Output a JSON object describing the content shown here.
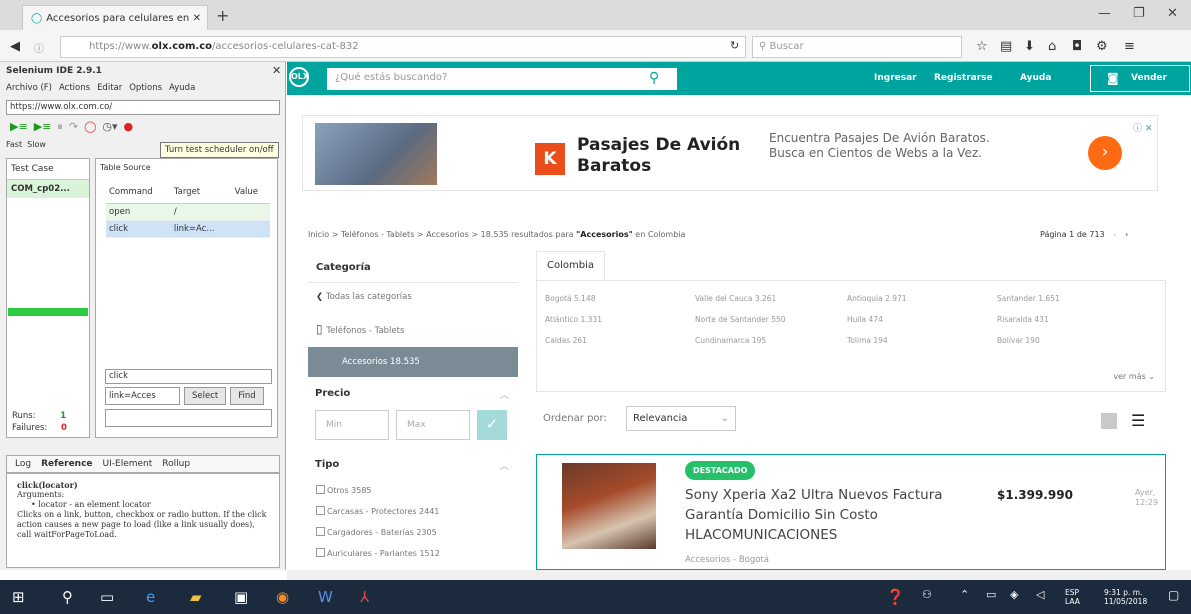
{
  "browser": {
    "tab_title": "Accesorios para celulares en",
    "url_prefix": "https://www.",
    "url_domain": "olx.com.co",
    "url_path": "/accesorios-celulares-cat-832",
    "search_placeholder": "Buscar"
  },
  "selenium": {
    "title": "Selenium IDE 2.9.1",
    "menu": [
      "Archivo (F)",
      "Actions",
      "Editar",
      "Options",
      "Ayuda"
    ],
    "base_url": "https://www.olx.com.co/",
    "speed_fast": "Fast",
    "speed_slow": "Slow",
    "tooltip": "Turn test scheduler on/off",
    "testcase_header": "Test Case",
    "testcase_item": "COM_cp02...",
    "editor_tab_table": "Table",
    "editor_tab_source": "Source",
    "col_command": "Command",
    "col_target": "Target",
    "col_value": "Value",
    "rows": [
      {
        "command": "open",
        "target": "/",
        "value": ""
      },
      {
        "command": "click",
        "target": "link=Ac...",
        "value": ""
      }
    ],
    "command_value": "click",
    "target_value": "link=Acces",
    "select_label": "Select",
    "find_label": "Find",
    "runs_label": "Runs:",
    "runs_value": "1",
    "failures_label": "Failures:",
    "failures_value": "0",
    "bottom_tabs": [
      "Log",
      "Reference",
      "UI-Element",
      "Rollup"
    ],
    "ref_title": "click(locator)",
    "ref_args": "Arguments:",
    "ref_arg1": "• locator - an element locator",
    "ref_desc": "Clicks on a link, button, checkbox or radio button. If the click action causes a new page to load (like a link usually does), call waitForPageToLoad."
  },
  "olx": {
    "search_placeholder": "¿Qué estás buscando?",
    "nav": [
      "Ingresar",
      "Registrarse",
      "Ayuda"
    ],
    "sell": "Vender",
    "ad_title": "Pasajes De Avión Baratos",
    "ad_desc": "Encuentra Pasajes De Avión Baratos. Busca en Cientos de Webs a la Vez.",
    "ad_badge": "K",
    "breadcrumb": "Inicio > Teléfonos - Tablets > Accesorios > 18.535 resultados para",
    "breadcrumb_query": "\"Accesorios\"",
    "breadcrumb_tail": "en Colombia",
    "pagination": "Página 1 de 713",
    "categoria": "Categoría",
    "cat_all": "Todas las categorías",
    "cat_phones": "Teléfonos - Tablets",
    "cat_selected": "Accesorios 18.535",
    "precio": "Precio",
    "min": "Min",
    "max": "Max",
    "tipo": "Tipo",
    "tipos": [
      "Otros 3585",
      "Carcasas - Protectores 2441",
      "Cargadores - Baterías 2305",
      "Auriculares - Parlantes 1512"
    ],
    "location_tab": "Colombia",
    "locations": [
      [
        "Bogotá 5.148",
        "Valle del Cauca 3.261",
        "Antioquia 2.971",
        "Santander 1.651"
      ],
      [
        "Atlántico 1.331",
        "Norte de Santander 550",
        "Huila 474",
        "Risaralda 431"
      ],
      [
        "Caldas 261",
        "Cundinamarca 195",
        "Tolima 194",
        "Bolívar 190"
      ]
    ],
    "ver_mas": "ver más",
    "ordenar": "Ordenar por:",
    "orden_value": "Relevancia",
    "item_badge": "DESTACADO",
    "item_title": "Sony Xperia Xa2 Ultra Nuevos Factura Garantía Domicilio Sin Costo HLACOMUNICACIONES",
    "item_price": "$1.399.990",
    "item_location": "Accesorios - Bogotá",
    "item_day": "Ayer,",
    "item_time": "12:29"
  },
  "taskbar": {
    "lang1": "ESP",
    "lang2": "LAA",
    "time": "9:31 p. m.",
    "date": "11/05/2018"
  }
}
